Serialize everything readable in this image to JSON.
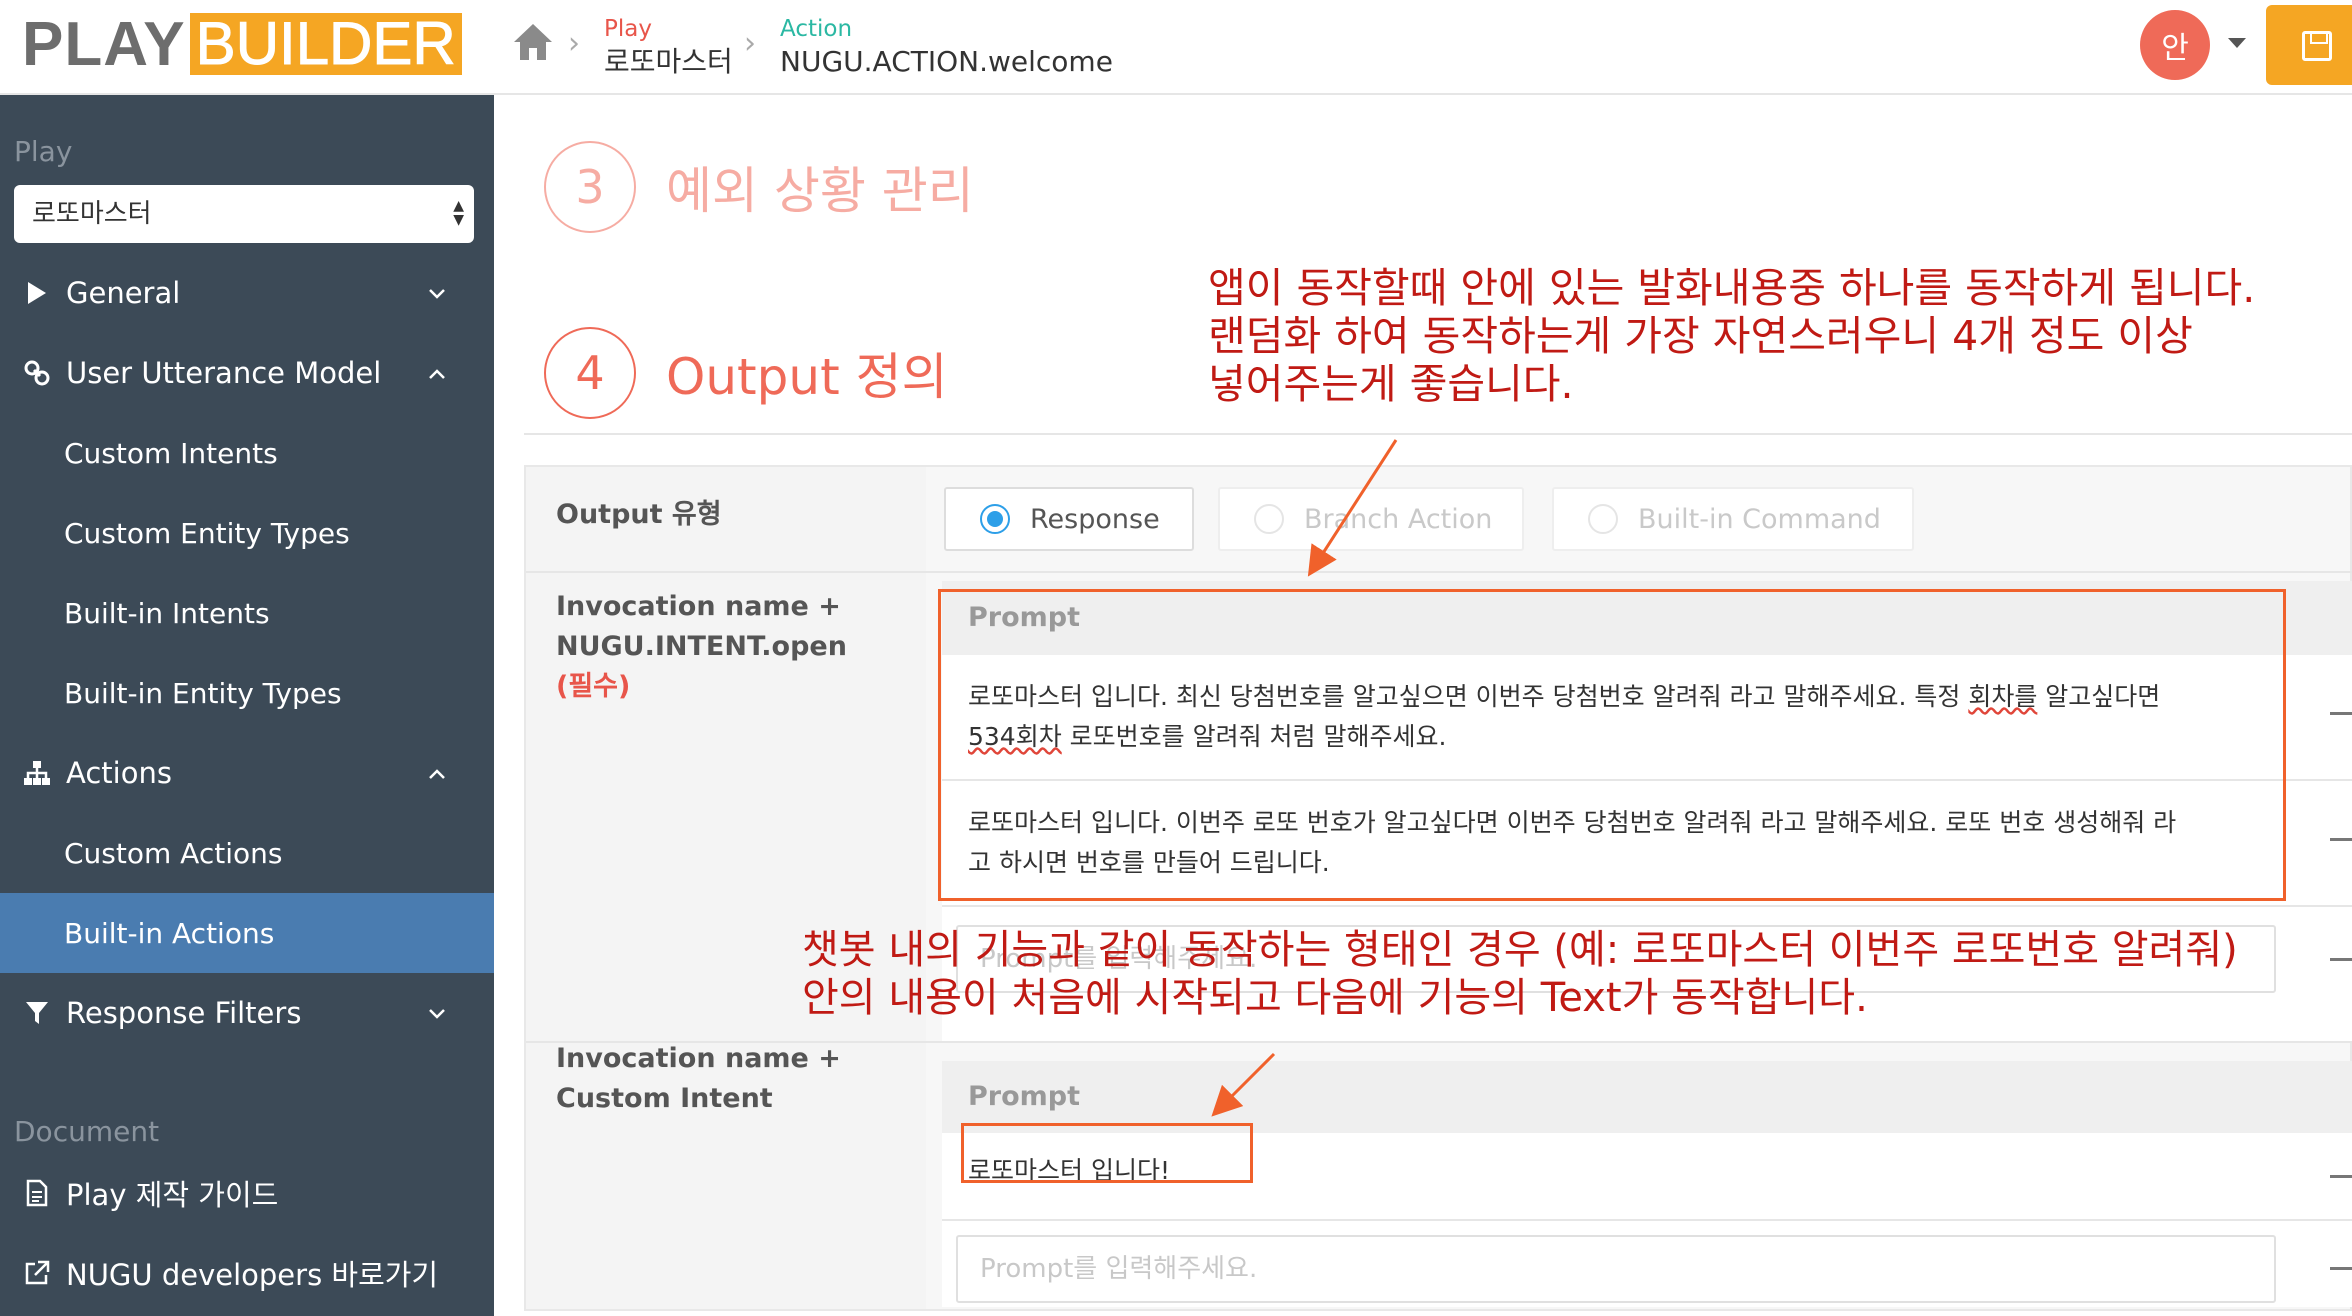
{
  "header": {
    "logo_play": "PLAY",
    "logo_builder": "BUILDER",
    "breadcrumb": [
      {
        "key": "Play",
        "value": "로또마스터",
        "key_color": "#e8554a"
      },
      {
        "key": "Action",
        "value": "NUGU.ACTION.welcome",
        "key_color": "#2bb8a3"
      }
    ],
    "avatar_initial": "안",
    "icons": {
      "home": "home-icon",
      "caret": "caret-down-icon",
      "save": "save-icon"
    }
  },
  "sidebar": {
    "play_section": "Play",
    "play_select": "로또마스터",
    "items": [
      {
        "label": "General",
        "icon": "play-triangle-icon",
        "chevron": "down"
      },
      {
        "label": "User Utterance Model",
        "icon": "link-icon",
        "chevron": "up"
      },
      {
        "label": "Custom Intents"
      },
      {
        "label": "Custom Entity Types"
      },
      {
        "label": "Built-in Intents"
      },
      {
        "label": "Built-in Entity Types"
      },
      {
        "label": "Actions",
        "icon": "sitemap-icon",
        "chevron": "up"
      },
      {
        "label": "Custom Actions"
      },
      {
        "label": "Built-in Actions",
        "active": true
      },
      {
        "label": "Response Filters",
        "icon": "filter-icon",
        "chevron": "down"
      }
    ],
    "document_section": "Document",
    "doc_items": [
      {
        "label": "Play 제작 가이드",
        "icon": "document-icon"
      },
      {
        "label": "NUGU developers 바로가기",
        "icon": "external-link-icon"
      }
    ],
    "colors": {
      "bg": "#3c4a57",
      "active": "#4a7cb0"
    }
  },
  "main": {
    "step3": {
      "number": "3",
      "title": "예외 상황 관리"
    },
    "step4": {
      "number": "4",
      "title": "Output 정의"
    },
    "output_type": {
      "label": "Output 유형",
      "options": [
        {
          "label": "Response",
          "selected": true
        },
        {
          "label": "Branch Action",
          "disabled": true
        },
        {
          "label": "Built-in Command",
          "disabled": true
        }
      ]
    },
    "invocation_open": {
      "label_line1": "Invocation name +",
      "label_line2": "NUGU.INTENT.open",
      "required": "(필수)",
      "prompt_header": "Prompt",
      "prompts": [
        {
          "pre": "로또마스터 입니다. 최신 당첨번호를 알고싶으면 이번주 당첨번호 알려줘 라고 말해주세요. 특정 ",
          "misspelled1": "회차를",
          "mid": " 알고싶다면",
          "misspelled2": "534회차",
          "post": " 로또번호를 알려줘 처럼 말해주세요."
        },
        {
          "line1": "로또마스터 입니다. 이번주 로또 번호가 알고싶다면 이번주 당첨번호 알려줘 라고 말해주세요. 로또 번호 생성해줘 라",
          "line2": "고 하시면 번호를 만들어 드립니다."
        }
      ],
      "input_placeholder": "Prompt를 입력해주세요."
    },
    "invocation_custom": {
      "label_line1": "Invocation name +",
      "label_line2": "Custom Intent",
      "prompt_header": "Prompt",
      "prompts": [
        "로또마스터 입니다!"
      ],
      "input_placeholder": "Prompt를 입력해주세요."
    }
  },
  "annotations": {
    "note1": [
      "앱이 동작할때 안에 있는 발화내용중 하나를 동작하게 됩니다.",
      "랜덤화 하여 동작하는게 가장 자연스러우니 4개 정도 이상",
      "넣어주는게 좋습니다."
    ],
    "note2": [
      "챗봇 내의 기능과 같이 동작하는 형태인 경우 (예: 로또마스터 이번주 로또번호 알려줘)",
      "안의 내용이 처음에 시작되고 다음에 기능의 Text가 동작합니다."
    ],
    "colors": {
      "text": "#c01a14",
      "box": "#f0612b"
    }
  }
}
